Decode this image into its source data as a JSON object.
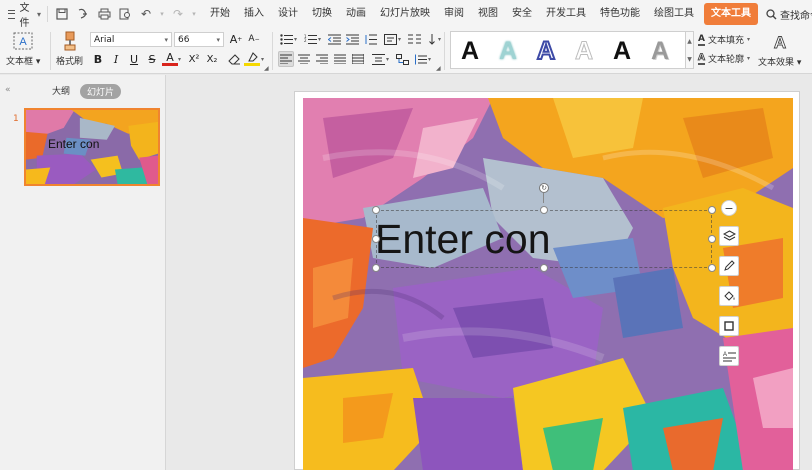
{
  "menubar": {
    "file_label": "文件",
    "quick_access_icons": [
      "save-icon",
      "export-pdf-icon",
      "print-icon",
      "print-preview-icon",
      "undo-icon",
      "redo-icon"
    ],
    "tabs": [
      "开始",
      "插入",
      "设计",
      "切换",
      "动画",
      "幻灯片放映",
      "审阅",
      "视图",
      "安全",
      "开发工具",
      "特色功能",
      "绘图工具",
      "文本工具"
    ],
    "active_tab": "文本工具",
    "search_label": "查找命令..."
  },
  "ribbon": {
    "textbox_label": "文本框",
    "format_painter_label": "格式刷",
    "font_name": "Arial",
    "font_size": "66",
    "text_fill_label": "文本填充",
    "text_outline_label": "文本轮廓",
    "text_effect_label": "文本效果",
    "style_colors": [
      "#111111",
      "#9fd3d3",
      "#3d4aa6",
      "#e8e8e8",
      "#111111",
      "#9a9a9a"
    ],
    "style_sample": "A",
    "bold": "B",
    "italic": "I",
    "underline": "U",
    "strike": "S",
    "font_color": "A"
  },
  "panel": {
    "outline_tab": "大纲",
    "slides_tab": "幻灯片",
    "slide_number": "1",
    "thumb_text": "Enter con"
  },
  "slide": {
    "text": "Enter con"
  },
  "colors": {
    "accent": "#f07d3a",
    "selection_border": "#f0842f"
  }
}
